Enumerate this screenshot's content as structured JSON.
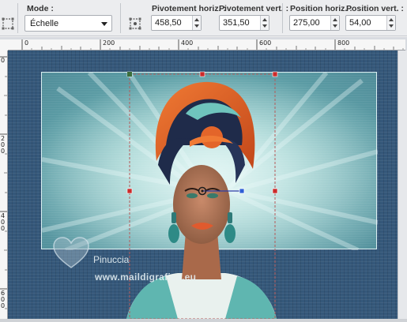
{
  "toolbar": {
    "mode": {
      "label": "Mode :",
      "value": "Échelle"
    },
    "pivot_h": {
      "label": "Pivotement horiz. :",
      "value": "458,50"
    },
    "pivot_v": {
      "label": "Pivotement vert. :",
      "value": "351,50"
    },
    "pos_h": {
      "label": "Position horiz. :",
      "value": "275,00"
    },
    "pos_v": {
      "label": "Position vert. :",
      "value": "54,00"
    }
  },
  "ruler": {
    "horizontal": [
      "0",
      "200",
      "400",
      "600",
      "800"
    ],
    "vertical": [
      "0",
      "2 0 0",
      "4 0 0",
      "6 0 0"
    ]
  },
  "watermark": {
    "name": "Pinuccia",
    "url": "www.maildigrafica.eu"
  },
  "icons": [
    "pick-tool-icon",
    "pivot-icon"
  ],
  "colors": {
    "selection_handle": "#cc2a2a",
    "selection_line": "#b55a5a",
    "rotation_handle": "#2f5fd6"
  }
}
